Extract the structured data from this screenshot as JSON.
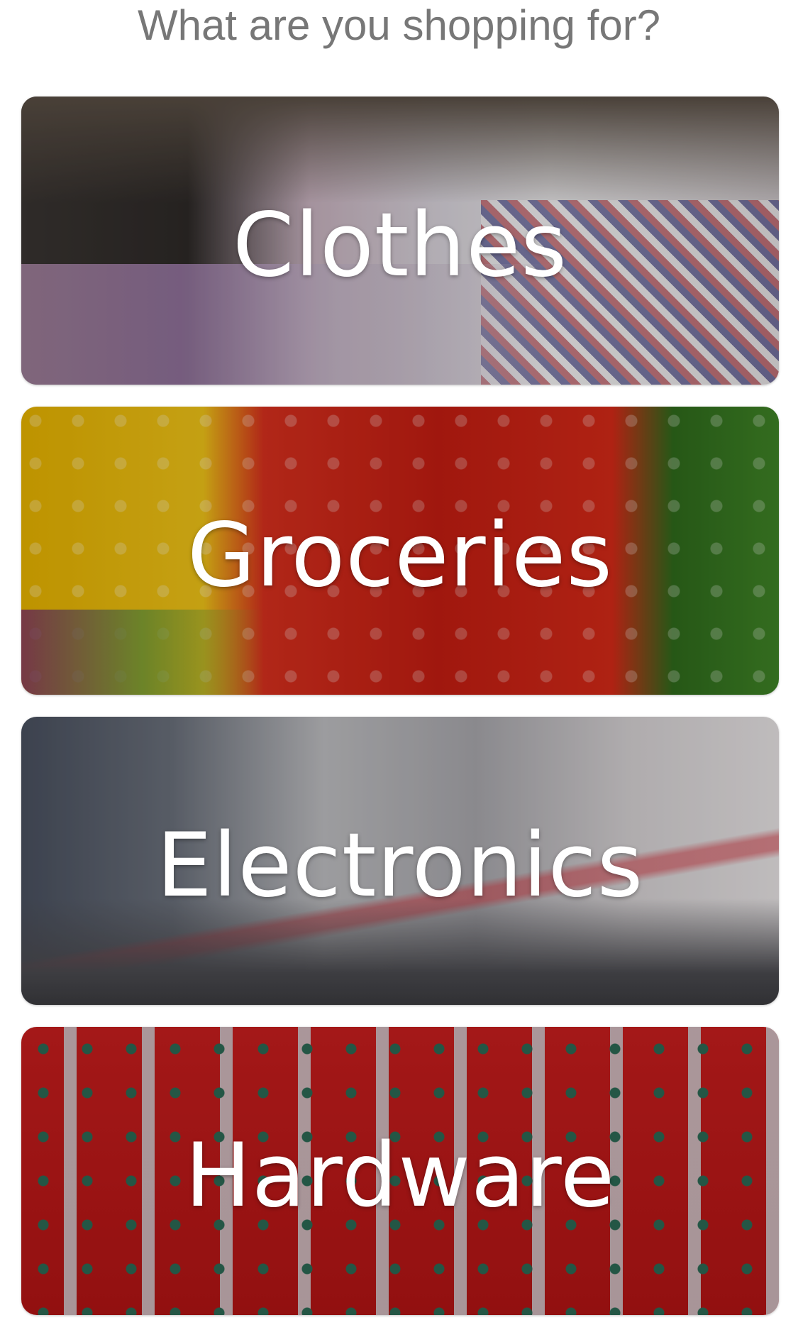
{
  "header": {
    "prompt": "What are you shopping for?"
  },
  "categories": [
    {
      "label": "Clothes",
      "image": "clothes-photo"
    },
    {
      "label": "Groceries",
      "image": "groceries-photo"
    },
    {
      "label": "Electronics",
      "image": "electronics-photo"
    },
    {
      "label": "Hardware",
      "image": "hardware-photo"
    }
  ],
  "colors": {
    "prompt_text": "#777777",
    "card_label": "#ffffff",
    "background": "#ffffff"
  }
}
